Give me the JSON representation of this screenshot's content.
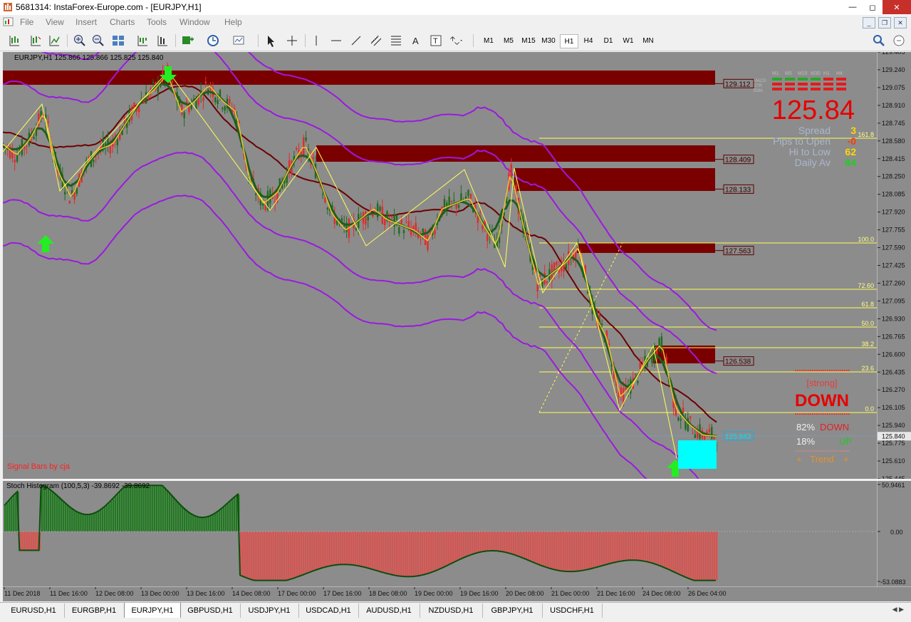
{
  "window": {
    "title": "5681314: InstaForex-Europe.com - [EURJPY,H1]"
  },
  "menu": [
    "File",
    "View",
    "Insert",
    "Charts",
    "Tools",
    "Window",
    "Help"
  ],
  "timeframes": {
    "items": [
      "M1",
      "M5",
      "M15",
      "M30",
      "H1",
      "H4",
      "D1",
      "W1",
      "MN"
    ],
    "active": "H1"
  },
  "chart": {
    "header": "EURJPY,H1  125.866 125.866 125.825 125.840",
    "signature": "Signal Bars by cja",
    "current_price": "125.843",
    "price_axis": [
      "129.405",
      "129.075",
      "128.745",
      "128.415",
      "128.085",
      "127.755",
      "127.425",
      "127.095",
      "126.765",
      "126.435",
      "126.105",
      "125.775",
      "125.445",
      "129.240",
      "128.910",
      "128.580",
      "128.250",
      "127.920",
      "127.590",
      "127.260",
      "126.930",
      "126.600",
      "126.270",
      "125.940",
      "125.610"
    ],
    "price_axis_current": "125.840",
    "price_axis_list": [
      "129.405",
      "129.240",
      "129.075",
      "128.910",
      "128.745",
      "128.580",
      "128.415",
      "128.250",
      "128.085",
      "127.920",
      "127.755",
      "127.590",
      "127.425",
      "127.260",
      "127.095",
      "126.930",
      "126.765",
      "126.600",
      "126.435",
      "126.270",
      "126.105",
      "125.940",
      "125.775",
      "125.610",
      "125.445"
    ],
    "zones": [
      {
        "label": "129.112"
      },
      {
        "label": "128.409"
      },
      {
        "label": "128.133"
      },
      {
        "label": "127.563"
      },
      {
        "label": "126.538"
      }
    ],
    "fib_levels": [
      "161.8",
      "100.0",
      "72.60",
      "61.8",
      "50.0",
      "38.2",
      "23.6",
      "0.0"
    ]
  },
  "signal_panel": {
    "timeframes": [
      "M1",
      "M5",
      "M15",
      "M30",
      "H1",
      "H4"
    ],
    "rows": [
      "MACD",
      "STR",
      "EMA"
    ],
    "big_price": "125.84",
    "stats": [
      {
        "label": "Spread",
        "value": "3",
        "color": "#ffd700"
      },
      {
        "label": "Pips to Open",
        "value": "-0",
        "color": "#ff3b00"
      },
      {
        "label": "Hi to Low",
        "value": "62",
        "color": "#ffd700"
      },
      {
        "label": "Daily Av",
        "value": "84",
        "color": "#1ecf1e"
      }
    ],
    "strength": "[strong]",
    "direction": "DOWN",
    "down_pct": "82%",
    "down_label": "DOWN",
    "up_pct": "18%",
    "up_label": "UP",
    "trend_label": "Trend"
  },
  "indicator": {
    "header": "Stoch Histogram (100,5,3) -39.8692 -39.8692",
    "scale": [
      "50.9461",
      "0.00",
      "-53.0883"
    ]
  },
  "time_axis": [
    "11 Dec 2018",
    "11 Dec 16:00",
    "12 Dec 08:00",
    "13 Dec 00:00",
    "13 Dec 16:00",
    "14 Dec 08:00",
    "17 Dec 00:00",
    "17 Dec 16:00",
    "18 Dec 08:00",
    "19 Dec 00:00",
    "19 Dec 16:00",
    "20 Dec 08:00",
    "21 Dec 00:00",
    "21 Dec 16:00",
    "24 Dec 08:00",
    "26 Dec 04:00"
  ],
  "symbol_tabs": {
    "items": [
      "EURUSD,H1",
      "EURGBP,H1",
      "EURJPY,H1",
      "GBPUSD,H1",
      "USDJPY,H1",
      "USDCAD,H1",
      "AUDUSD,H1",
      "NZDUSD,H1",
      "GBPJPY,H1",
      "USDCHF,H1"
    ],
    "active": "EURJPY,H1"
  },
  "colors": {
    "background": "#8c8c8c",
    "zone": "#7a0000",
    "bull": "#1f7a1f",
    "bear": "#d9534f",
    "envelope": "#9a1ae0",
    "fib": "#ffff55",
    "arrow": "#22ee22",
    "box": "#00ffff"
  },
  "icons": [
    "app-icon",
    "new-order-icon",
    "indicator-icon",
    "zoom-in-icon",
    "zoom-out-icon",
    "tile-icon",
    "properties-icon",
    "arrow-cursor-icon",
    "crosshair-icon",
    "vertical-line-icon",
    "horizontal-line-icon",
    "trendline-icon",
    "channel-icon",
    "fibonacci-icon",
    "text-icon",
    "text-label-icon",
    "arrows-icon",
    "search-icon"
  ],
  "chart_data": {
    "type": "candlestick",
    "symbol": "EURJPY",
    "timeframe": "H1",
    "series": [
      {
        "name": "price",
        "values": [
          128.55,
          128.45,
          128.6,
          128.85,
          128.3,
          128.05,
          128.35,
          128.5,
          128.55,
          128.75,
          128.95,
          129.05,
          129.2,
          128.85,
          128.95,
          129.1,
          128.95,
          128.85,
          128.2,
          128.0,
          128.1,
          128.35,
          128.55,
          128.25,
          127.9,
          127.75,
          127.85,
          127.95,
          127.85,
          127.8,
          127.75,
          127.65,
          127.95,
          128.0,
          128.05,
          127.8,
          127.6,
          128.3,
          127.75,
          127.25,
          127.35,
          127.45,
          127.6,
          127.0,
          126.75,
          126.2,
          126.35,
          126.55,
          126.7,
          126.1,
          125.95,
          125.85,
          125.84
        ]
      }
    ]
  }
}
